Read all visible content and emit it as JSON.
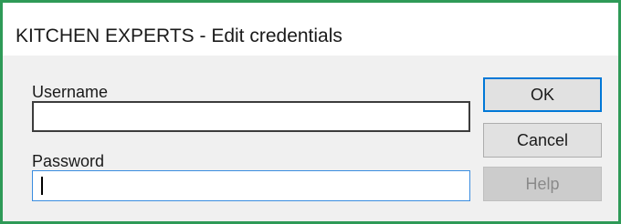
{
  "window": {
    "title": "KITCHEN EXPERTS - Edit credentials"
  },
  "form": {
    "username_label": "Username",
    "username_value": "",
    "password_label": "Password",
    "password_value": ""
  },
  "buttons": {
    "ok_label": "OK",
    "cancel_label": "Cancel",
    "help_label": "Help",
    "help_disabled": true
  },
  "colors": {
    "window_border": "#2e9a57",
    "focus_accent": "#0078d7"
  }
}
